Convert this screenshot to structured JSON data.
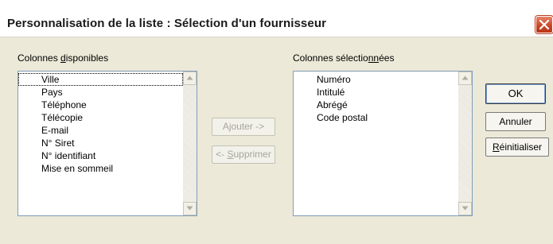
{
  "window": {
    "title": "Personnalisation de la liste : Sélection d'un fournisseur"
  },
  "available": {
    "label_pre": "Colonnes ",
    "label_mnemonic": "d",
    "label_post": "isponibles",
    "items": [
      "Ville",
      "Pays",
      "Téléphone",
      "Télécopie",
      "E-mail",
      "N° Siret",
      "N° identifiant",
      "Mise en sommeil"
    ]
  },
  "selected": {
    "label_pre": "Colonnes sélectio",
    "label_mnemonic": "nn",
    "label_post": "ées",
    "items": [
      "Numéro",
      "Intitulé",
      "Abrégé",
      "Code postal"
    ]
  },
  "buttons": {
    "add": "Ajouter ->",
    "remove_pre": "<- ",
    "remove_mnemonic": "S",
    "remove_post": "upprimer",
    "ok": "OK",
    "cancel": "Annuler",
    "reset_mnemonic": "R",
    "reset_post": "éinitialiser"
  },
  "colors": {
    "dialog_bg": "#ece9d8",
    "list_border": "#7f9db9",
    "close_red": "#c84524"
  }
}
